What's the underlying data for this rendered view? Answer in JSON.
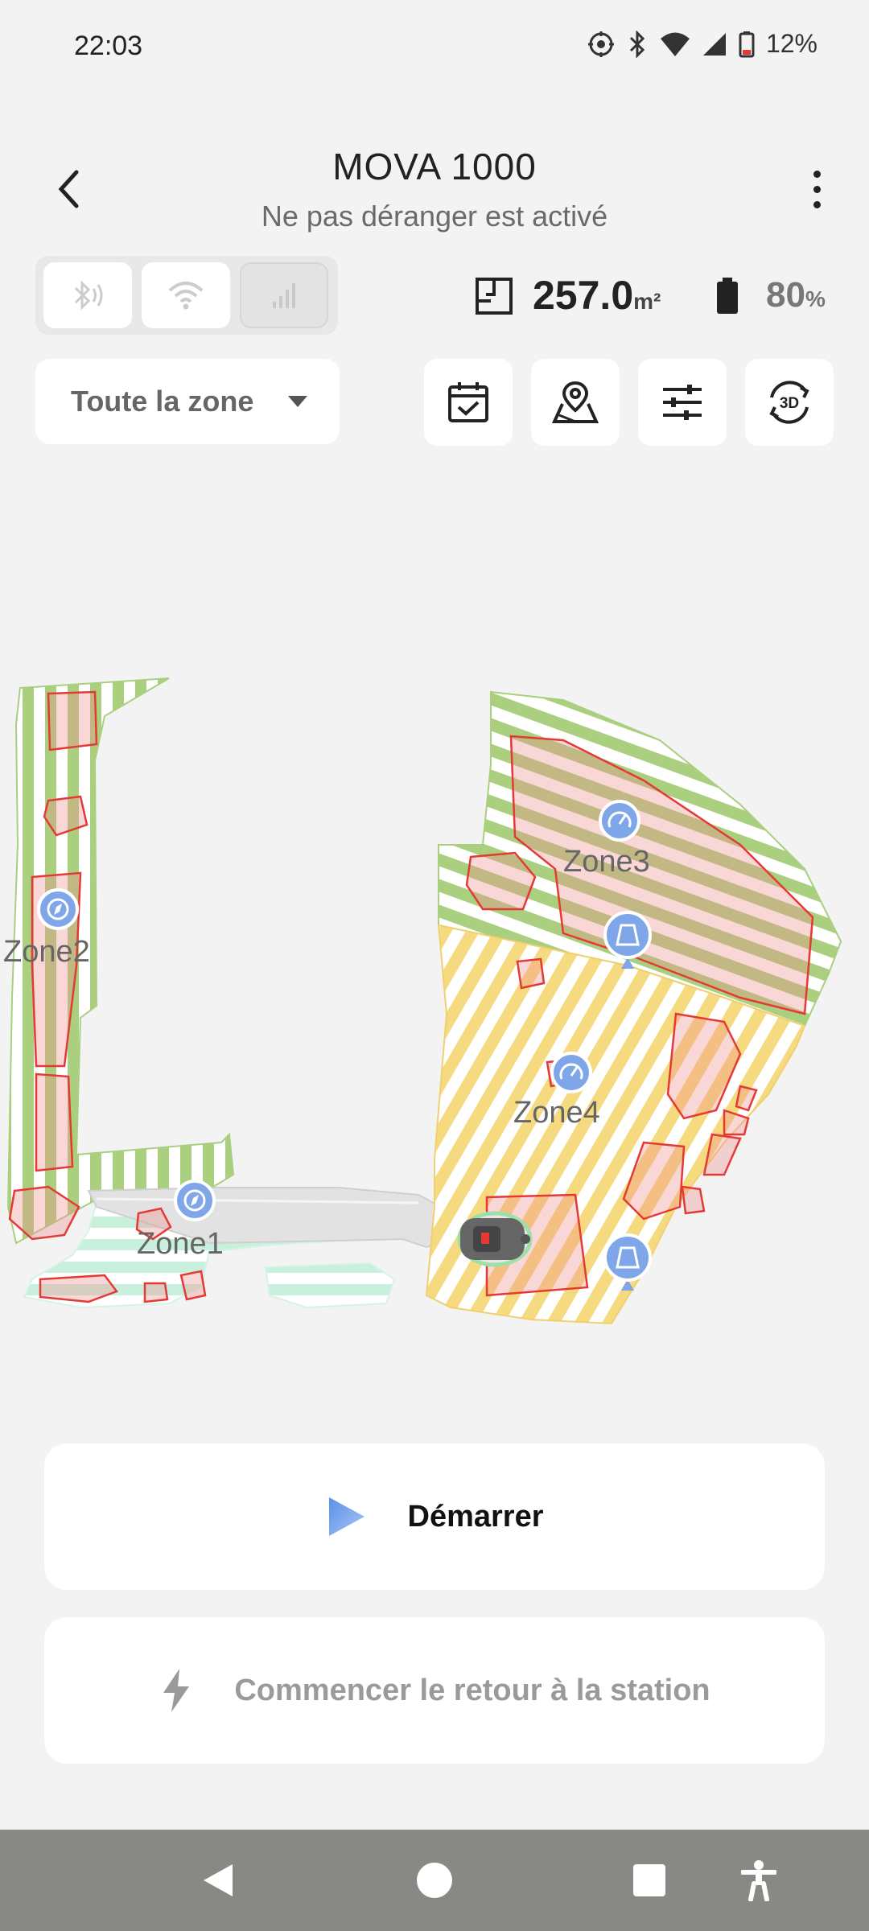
{
  "status_bar": {
    "time": "22:03",
    "battery_percent": "12%",
    "icons": [
      "location-target-icon",
      "bluetooth-icon",
      "wifi-icon",
      "signal-icon",
      "battery-low-icon"
    ]
  },
  "header": {
    "title": "MOVA 1000",
    "subtitle": "Ne pas déranger est activé"
  },
  "connectivity": {
    "items": [
      {
        "name": "bluetooth",
        "icon": "bluetooth-signal-icon",
        "enabled": true
      },
      {
        "name": "wifi",
        "icon": "wifi-icon",
        "enabled": true
      },
      {
        "name": "cellular",
        "icon": "cellular-bars-icon",
        "enabled": false
      }
    ]
  },
  "stats": {
    "area_value": "257.0",
    "area_unit": "m²",
    "battery_value": "80",
    "battery_unit": "%"
  },
  "zone_select": {
    "selected": "Toute la zone"
  },
  "toolbar": {
    "icons": [
      "calendar-check-icon",
      "map-pin-icon",
      "sliders-icon",
      "rotate-3d-icon"
    ],
    "label_3d": "3D"
  },
  "map": {
    "zones": [
      "Zone1",
      "Zone2",
      "Zone3",
      "Zone4"
    ]
  },
  "actions": {
    "start_label": "Démarrer",
    "return_label": "Commencer le retour à la station"
  },
  "colors": {
    "green_stripe": "#a9cf7f",
    "yellow_stripe": "#f6da7f",
    "mint_stripe": "#c9f0dd",
    "no_go_outline": "#e53935",
    "marker_blue": "#7ea6e8",
    "play_blue": "#7aa6ef"
  }
}
